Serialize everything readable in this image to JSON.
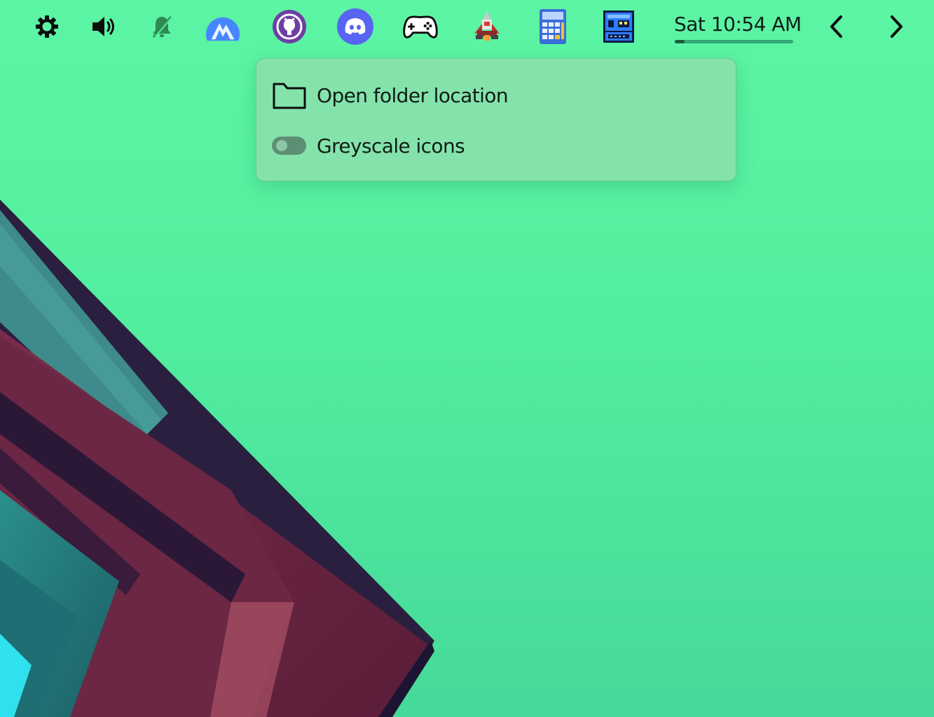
{
  "topbar": {
    "icons": [
      {
        "name": "settings-gear-icon"
      },
      {
        "name": "volume-icon"
      },
      {
        "name": "notifications-muted-icon"
      },
      {
        "name": "nordvpn-icon"
      },
      {
        "name": "github-icon"
      },
      {
        "name": "discord-icon"
      },
      {
        "name": "gamepad-icon"
      },
      {
        "name": "rocket-game-icon"
      },
      {
        "name": "calculator-icon"
      },
      {
        "name": "pixel-robot-icon"
      }
    ],
    "clock": {
      "text": "Sat 10:54 AM",
      "progress": 0.08
    },
    "nav": {
      "prev": "chevron-left-icon",
      "next": "chevron-right-icon"
    }
  },
  "context_menu": {
    "items": [
      {
        "label": "Open folder location",
        "icon": "folder-icon"
      },
      {
        "label": "Greyscale icons",
        "icon": "toggle-switch",
        "toggle_on": false
      }
    ]
  },
  "colors": {
    "background_top": "#5cf5a4",
    "background_bottom": "#46d99a",
    "menu_bg": "#85e2ab",
    "text": "#101c15",
    "discord": "#5865f2",
    "github": "#6e3fa3",
    "nordvpn": "#4687ff"
  }
}
